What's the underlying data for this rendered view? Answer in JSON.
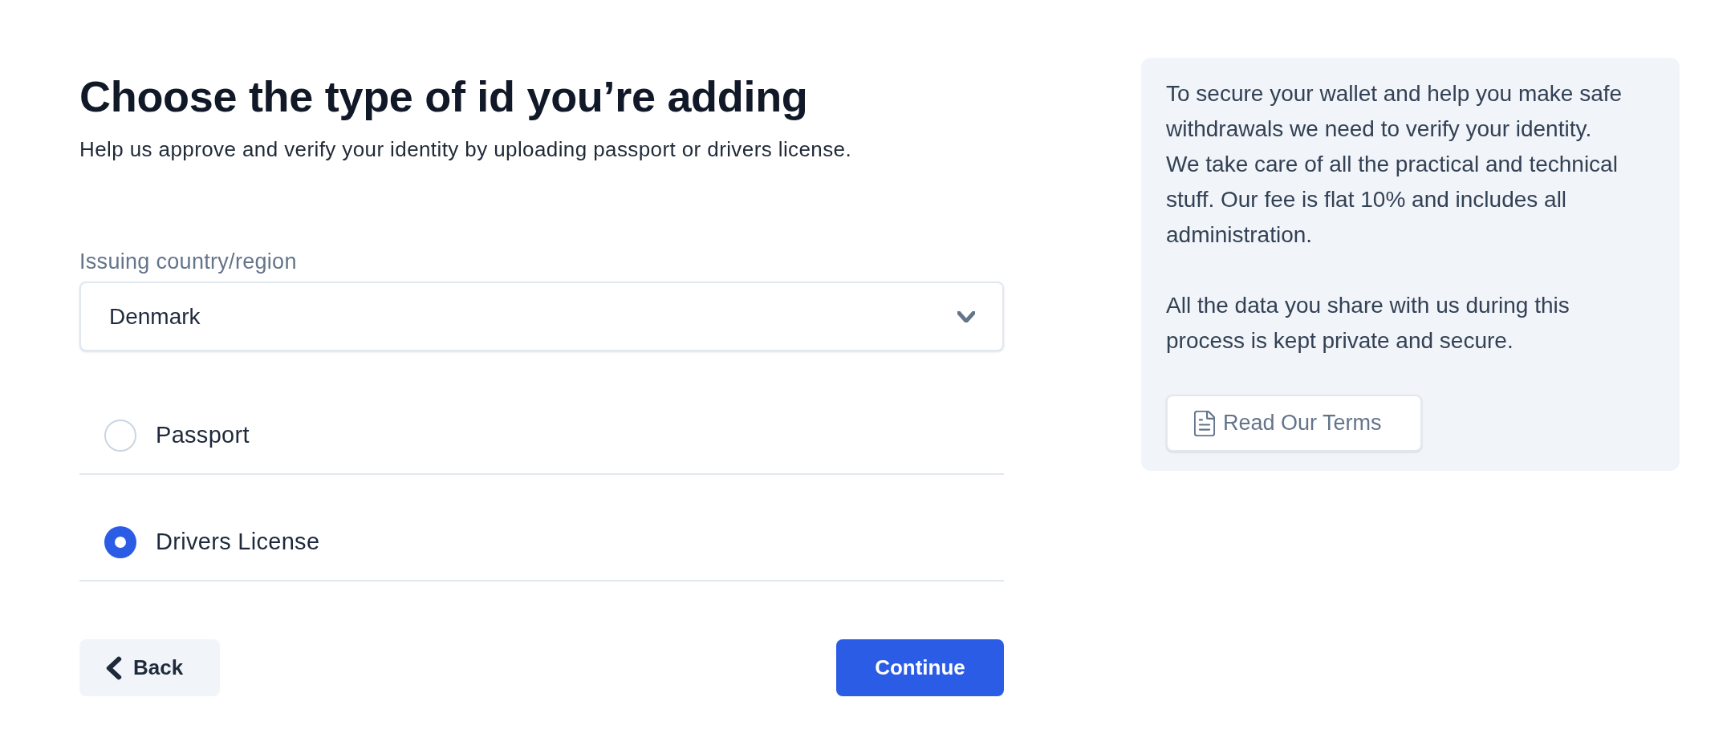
{
  "heading": "Choose the type of id you’re adding",
  "subtitle": "Help us approve and verify your identity by uploading passport or drivers license.",
  "country_select": {
    "label": "Issuing country/region",
    "value": "Denmark"
  },
  "id_types": [
    {
      "label": "Passport",
      "selected": false
    },
    {
      "label": "Drivers License",
      "selected": true
    }
  ],
  "buttons": [
    {
      "label": "Back",
      "kind": "secondary"
    },
    {
      "label": "Continue",
      "kind": "primary"
    }
  ],
  "info_panel": {
    "paragraphs": [
      "To secure your wallet and help you make safe withdrawals we need to verify your identity.\nWe take care of all the practical and technical stuff. Our fee is flat 10% and includes all administration.",
      "All the data you share with us during this process is kept private and secure."
    ],
    "button": "Read Our Terms"
  }
}
